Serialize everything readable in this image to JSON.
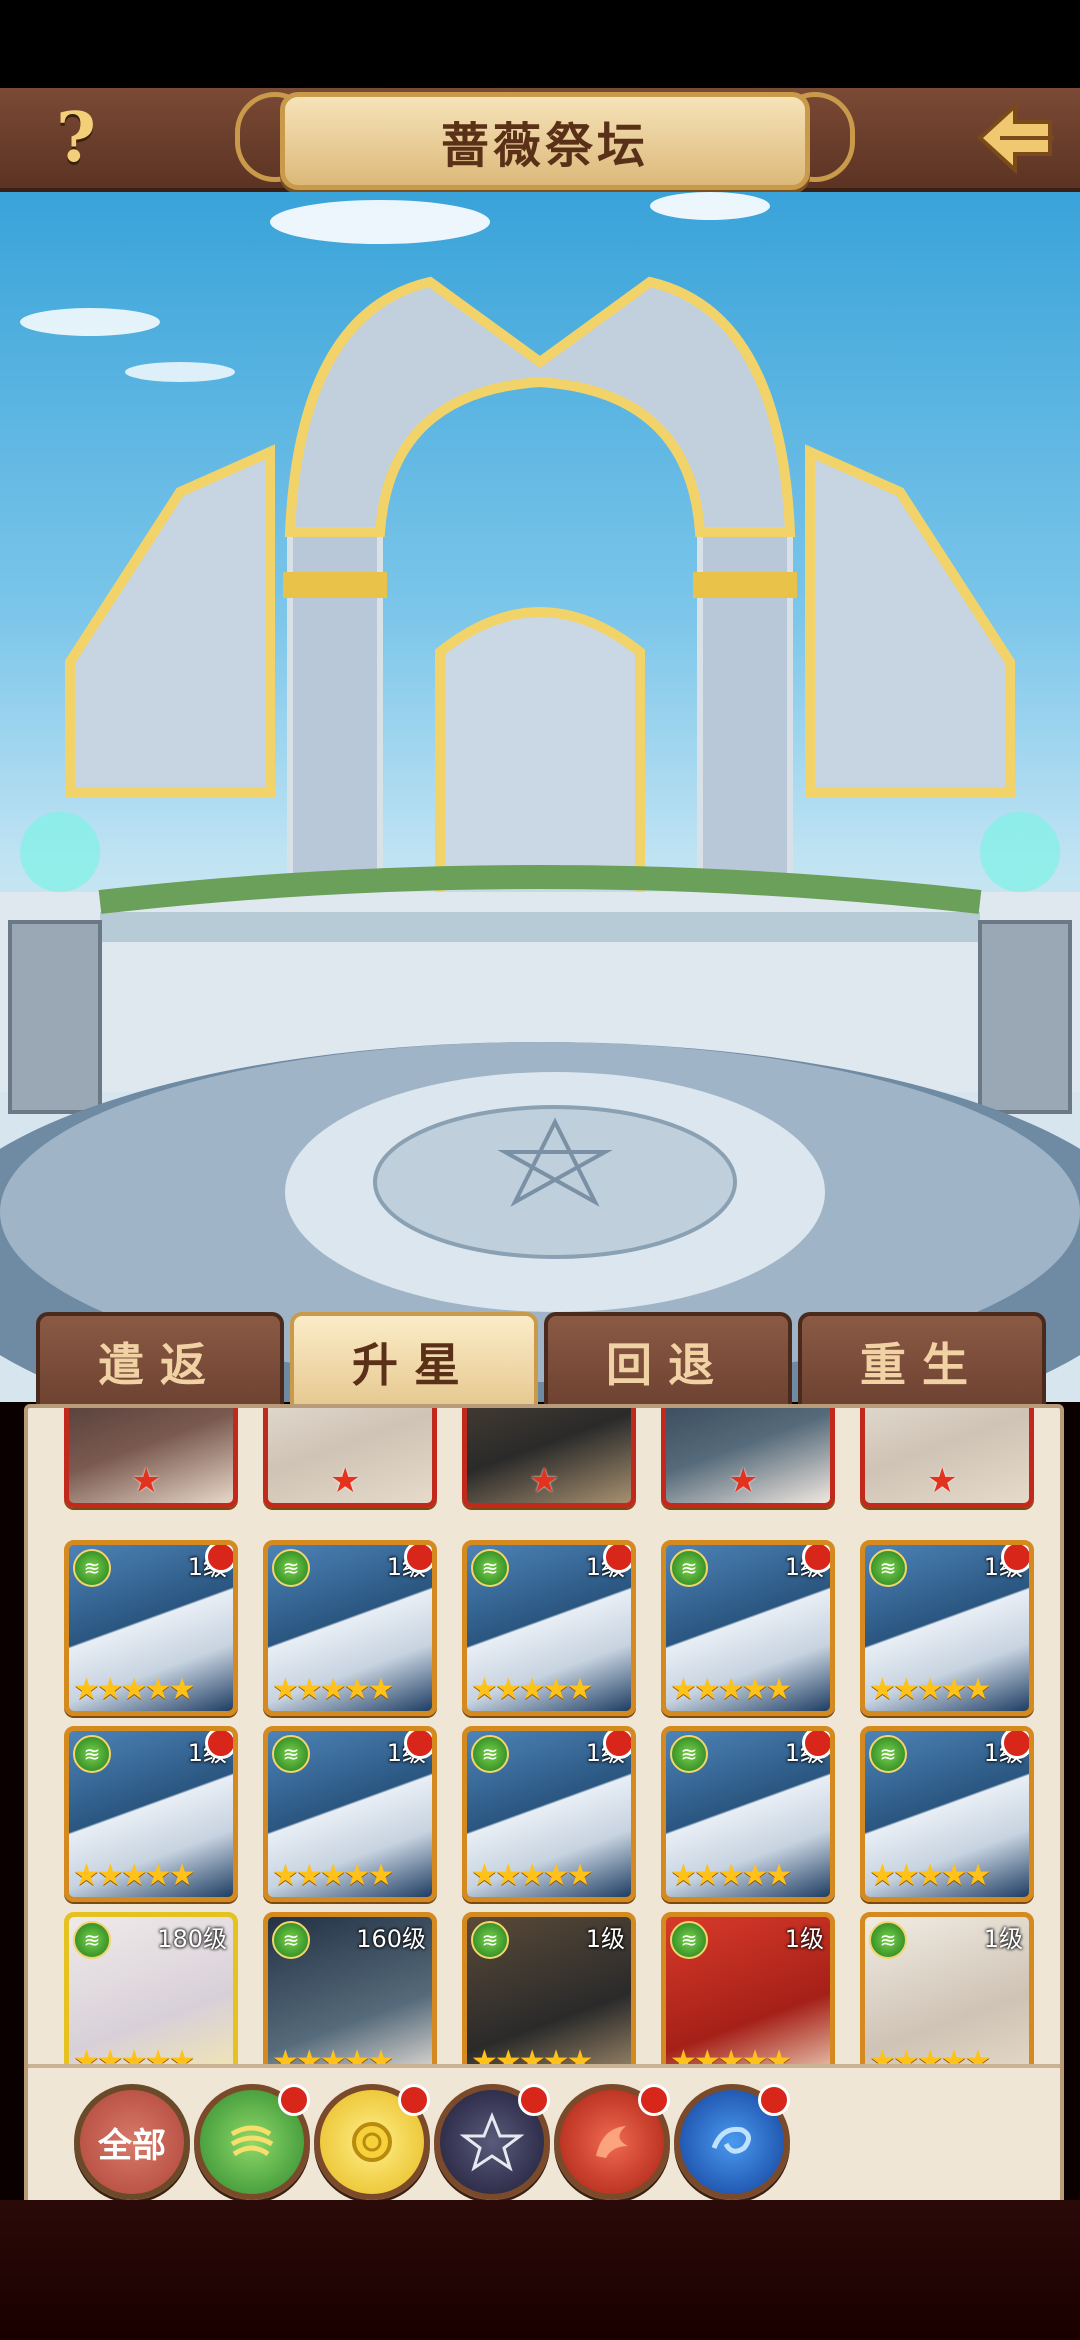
{
  "header": {
    "title": "蔷薇祭坛",
    "help_icon": "?",
    "back_icon": "back-arrow-icon"
  },
  "tabs": [
    {
      "label": "遣返",
      "active": false
    },
    {
      "label": "升星",
      "active": true
    },
    {
      "label": "回退",
      "active": false
    },
    {
      "label": "重生",
      "active": false
    }
  ],
  "grid": {
    "partial_row": [
      {
        "style": "red"
      },
      {
        "style": "red"
      },
      {
        "style": "red"
      },
      {
        "style": "red"
      },
      {
        "style": "red"
      }
    ],
    "rows": [
      [
        {
          "level": "1级",
          "stars": "★★★★★",
          "element": "wind",
          "dot": true
        },
        {
          "level": "1级",
          "stars": "★★★★★",
          "element": "wind",
          "dot": true
        },
        {
          "level": "1级",
          "stars": "★★★★★",
          "element": "wind",
          "dot": true
        },
        {
          "level": "1级",
          "stars": "★★★★★",
          "element": "wind",
          "dot": true
        },
        {
          "level": "1级",
          "stars": "★★★★★",
          "element": "wind",
          "dot": true
        }
      ],
      [
        {
          "level": "1级",
          "stars": "★★★★★",
          "element": "wind",
          "dot": true
        },
        {
          "level": "1级",
          "stars": "★★★★★",
          "element": "wind",
          "dot": true
        },
        {
          "level": "1级",
          "stars": "★★★★★",
          "element": "wind",
          "dot": true
        },
        {
          "level": "1级",
          "stars": "★★★★★",
          "element": "wind",
          "dot": true
        },
        {
          "level": "1级",
          "stars": "★★★★★",
          "element": "wind",
          "dot": true
        }
      ],
      [
        {
          "level": "180级",
          "stars": "★★★★★",
          "element": "wind"
        },
        {
          "level": "160级",
          "stars": "★★★★★",
          "element": "wind"
        },
        {
          "level": "1级",
          "stars": "★★★★★",
          "element": "wind"
        },
        {
          "level": "1级",
          "stars": "★★★★★",
          "element": "wind"
        },
        {
          "level": "1级",
          "stars": "★★★★★",
          "element": "wind"
        }
      ]
    ]
  },
  "filters": [
    {
      "label": "全部",
      "icon": "all-filter"
    },
    {
      "label": "",
      "icon": "wind-element-icon",
      "color": "#2e8b2e",
      "dot": true
    },
    {
      "label": "",
      "icon": "rose-element-icon",
      "color": "#e7b91c",
      "dot": true
    },
    {
      "label": "",
      "icon": "star-element-icon",
      "color": "#2a2a4a",
      "dot": true
    },
    {
      "label": "",
      "icon": "phoenix-element-icon",
      "color": "#c8281c",
      "dot": true
    },
    {
      "label": "",
      "icon": "water-element-icon",
      "color": "#1e5ac8",
      "dot": true
    }
  ]
}
